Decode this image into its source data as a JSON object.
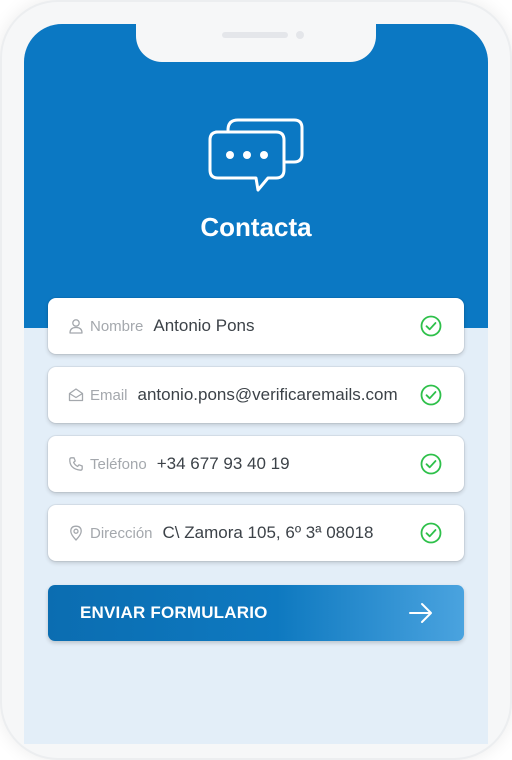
{
  "header": {
    "title": "Contacta",
    "icon": "chat-bubbles-icon"
  },
  "form": {
    "fields": [
      {
        "label": "Nombre",
        "value": "Antonio Pons",
        "icon": "user-icon",
        "status": "valid"
      },
      {
        "label": "Email",
        "value": "antonio.pons@verificaremails.com",
        "icon": "envelope-icon",
        "status": "valid"
      },
      {
        "label": "Teléfono",
        "value": "+34 677 93 40 19",
        "icon": "phone-icon",
        "status": "valid"
      },
      {
        "label": "Dirección",
        "value": "C\\ Zamora 105, 6º 3ª 08018",
        "icon": "location-pin-icon",
        "status": "valid"
      }
    ],
    "submit_label": "ENVIAR FORMULARIO"
  },
  "colors": {
    "primary": "#0b78c3",
    "background": "#e3eef8",
    "valid": "#2ec04a",
    "label": "#a4a8ad",
    "value": "#3c4248"
  }
}
